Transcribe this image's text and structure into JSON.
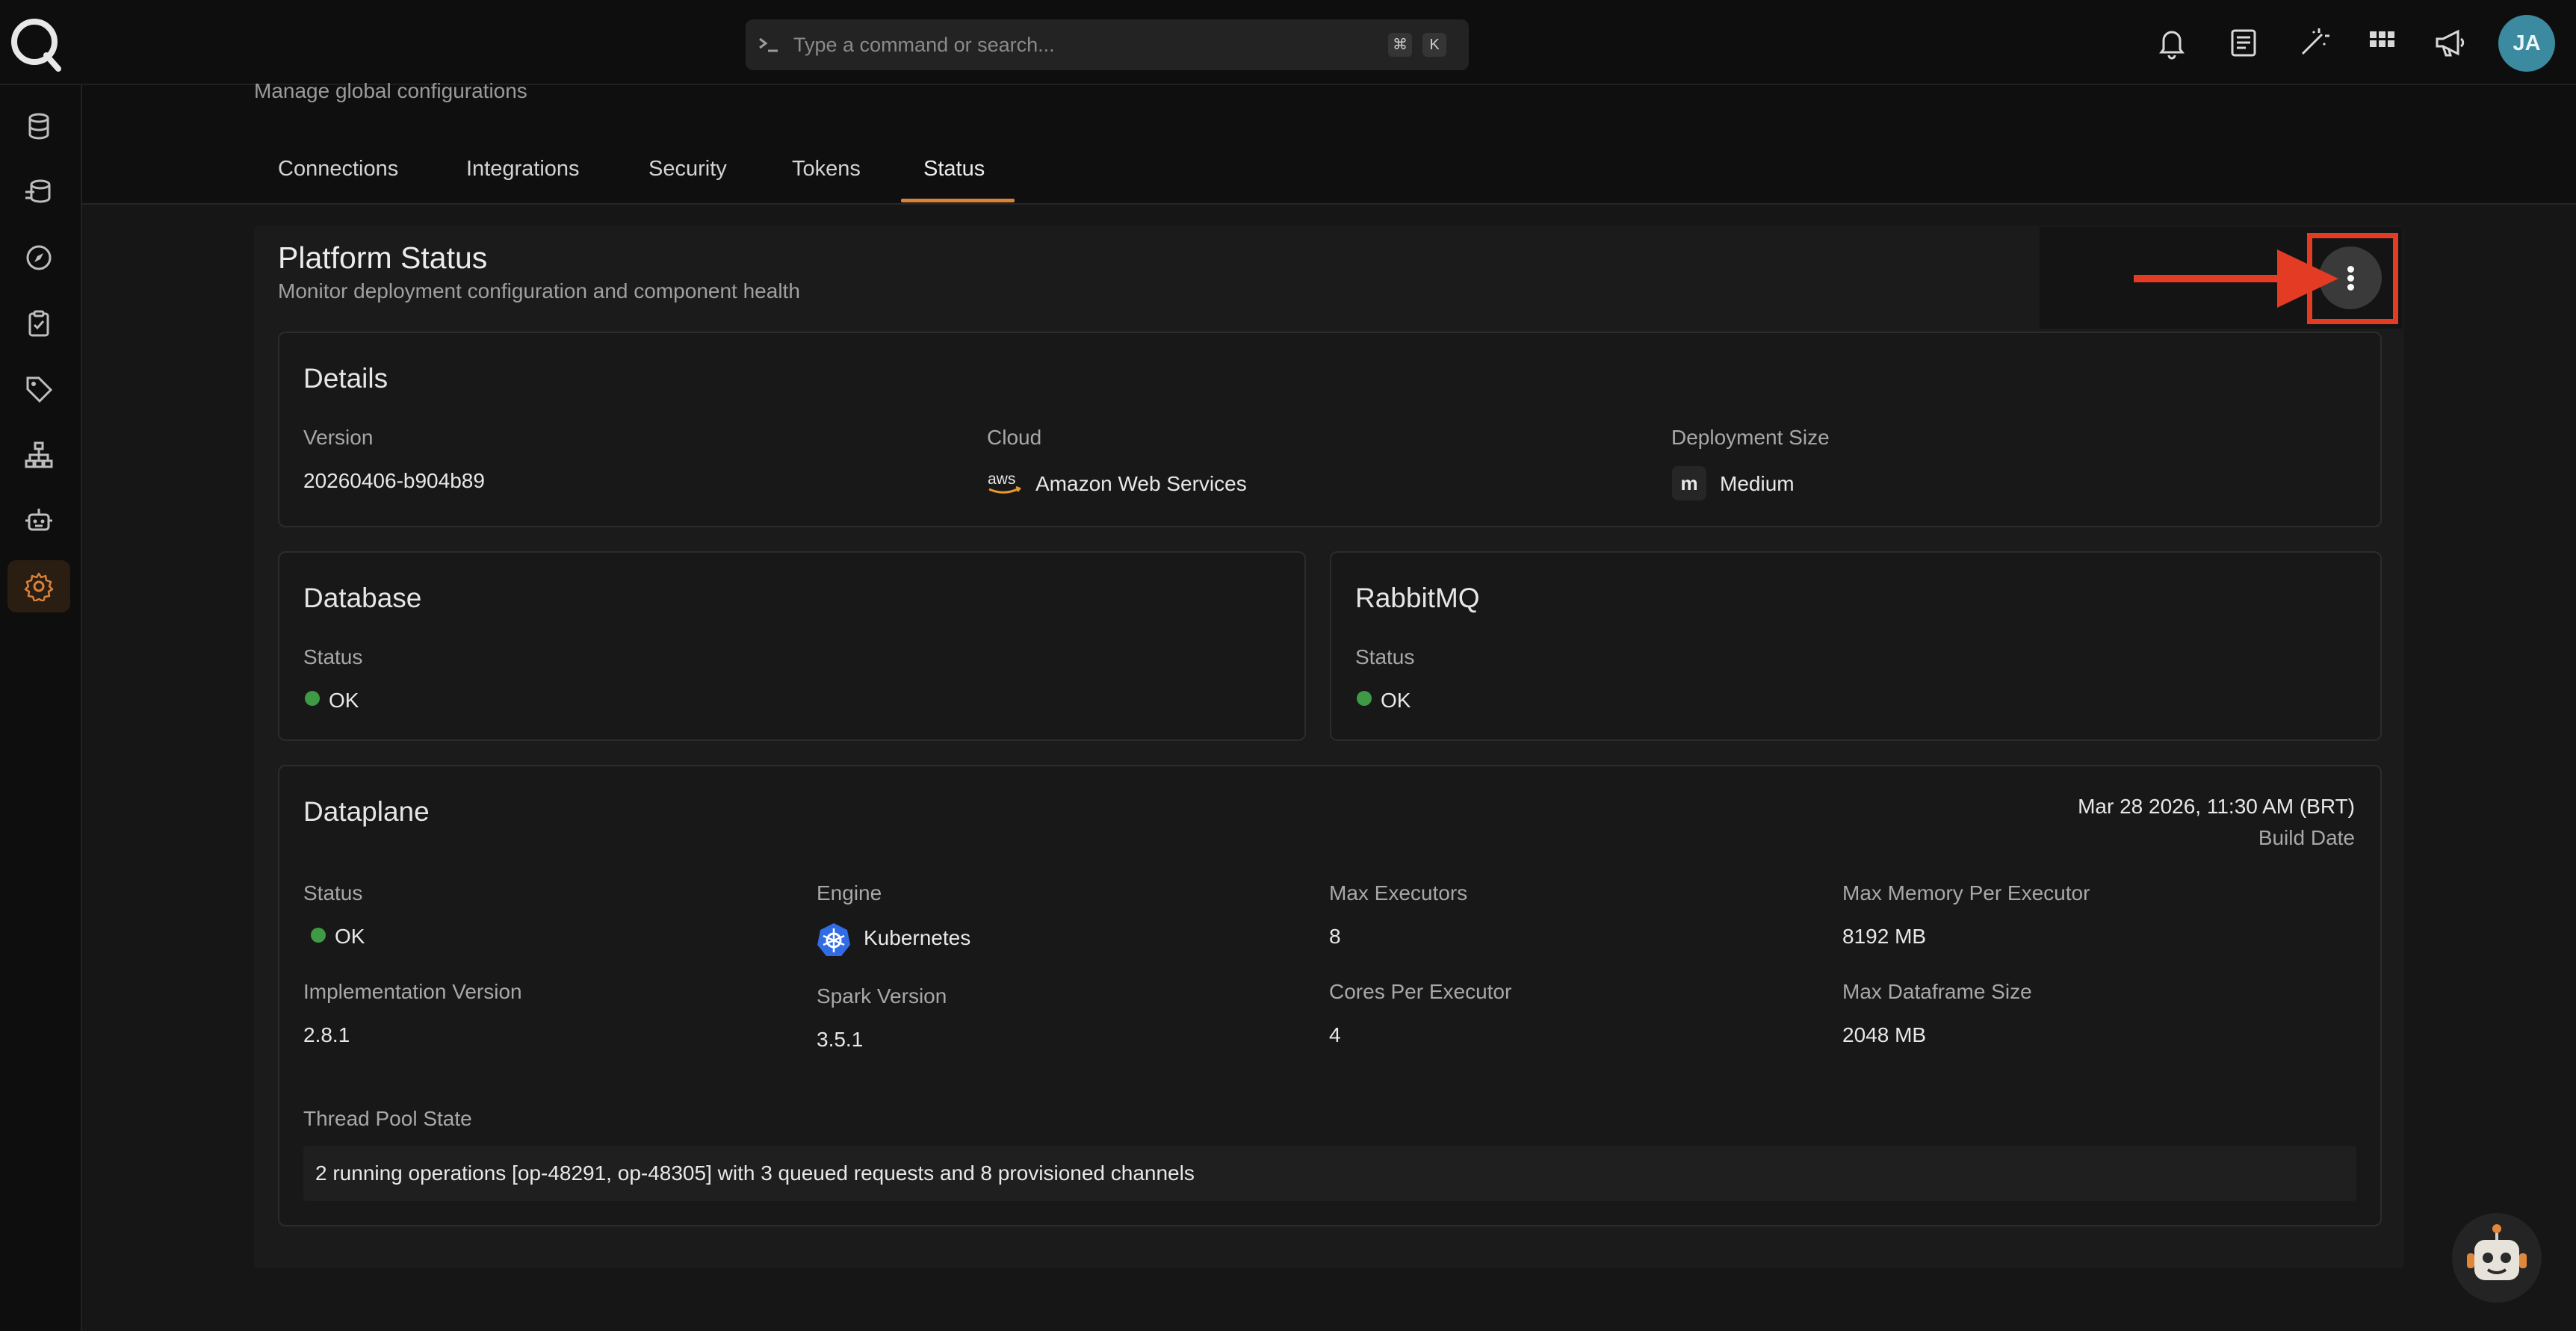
{
  "search": {
    "placeholder": "Type a command or search...",
    "shortcut_keys": [
      "⌘",
      "K"
    ]
  },
  "user": {
    "initials": "JA"
  },
  "header": {
    "subtitle": "Manage global configurations"
  },
  "tabs": [
    {
      "label": "Connections"
    },
    {
      "label": "Integrations"
    },
    {
      "label": "Security"
    },
    {
      "label": "Tokens"
    },
    {
      "label": "Status",
      "active": true
    }
  ],
  "platform": {
    "title": "Platform Status",
    "subtitle": "Monitor deployment configuration and component health"
  },
  "details": {
    "title": "Details",
    "version_label": "Version",
    "version_value": "20260406-b904b89",
    "cloud_label": "Cloud",
    "cloud_value": "Amazon Web Services",
    "cloud_logo_text": "aws",
    "size_label": "Deployment Size",
    "size_badge": "m",
    "size_value": "Medium"
  },
  "database": {
    "title": "Database",
    "status_label": "Status",
    "status_value": "OK"
  },
  "rabbitmq": {
    "title": "RabbitMQ",
    "status_label": "Status",
    "status_value": "OK"
  },
  "dataplane": {
    "title": "Dataplane",
    "build_date": "Mar 28 2026, 11:30 AM (BRT)",
    "build_date_label": "Build Date",
    "status_label": "Status",
    "status_value": "OK",
    "engine_label": "Engine",
    "engine_value": "Kubernetes",
    "max_executors_label": "Max Executors",
    "max_executors_value": "8",
    "max_memory_label": "Max Memory Per Executor",
    "max_memory_value": "8192 MB",
    "impl_version_label": "Implementation Version",
    "impl_version_value": "2.8.1",
    "spark_version_label": "Spark Version",
    "spark_version_value": "3.5.1",
    "cores_label": "Cores Per Executor",
    "cores_value": "4",
    "max_df_label": "Max Dataframe Size",
    "max_df_value": "2048 MB",
    "thread_pool_label": "Thread Pool State",
    "thread_pool_value": "2 running operations [op-48291, op-48305] with 3 queued requests and 8 provisioned channels"
  },
  "colors": {
    "accent": "#d9823a",
    "status_ok": "#3e9a45",
    "annotation": "#e33b24",
    "avatar": "#3b8aa0"
  },
  "icons": {
    "sidebar": [
      "database-icon",
      "data-stack-icon",
      "compass-icon",
      "clipboard-check-icon",
      "tag-icon",
      "hierarchy-icon",
      "robot-icon",
      "gear-icon"
    ],
    "topbar": [
      "bell-icon",
      "document-icon",
      "magic-wand-icon",
      "grid-icon",
      "megaphone-icon"
    ]
  }
}
